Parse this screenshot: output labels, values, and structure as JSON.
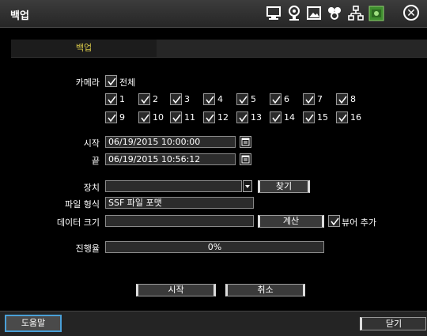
{
  "window": {
    "title": "백업"
  },
  "toolbar_icons": [
    "monitor-icon",
    "camera-icon",
    "image-icon",
    "network-icon",
    "hierarchy-icon",
    "green-disk-icon"
  ],
  "tab": {
    "label": "백업"
  },
  "camera": {
    "label": "카메라",
    "all_label": "전체",
    "channels": [
      "1",
      "2",
      "3",
      "4",
      "5",
      "6",
      "7",
      "8",
      "9",
      "10",
      "11",
      "12",
      "13",
      "14",
      "15",
      "16"
    ]
  },
  "start": {
    "label": "시작",
    "value": "06/19/2015 10:00:00"
  },
  "end": {
    "label": "끝",
    "value": "06/19/2015 10:56:12"
  },
  "device": {
    "label": "장치",
    "value": "",
    "find_button": "찾기"
  },
  "file_format": {
    "label": "파일 형식",
    "value": "SSF 파일 포맷"
  },
  "data_size": {
    "label": "데이터 크기",
    "value": "",
    "calc_button": "계산",
    "viewer_label": "뷰어 추가"
  },
  "progress": {
    "label": "진행율",
    "text": "0%",
    "value": 0
  },
  "actions": {
    "start_button": "시작",
    "cancel_button": "취소"
  },
  "footer": {
    "help_button": "도움말",
    "close_button": "닫기"
  }
}
